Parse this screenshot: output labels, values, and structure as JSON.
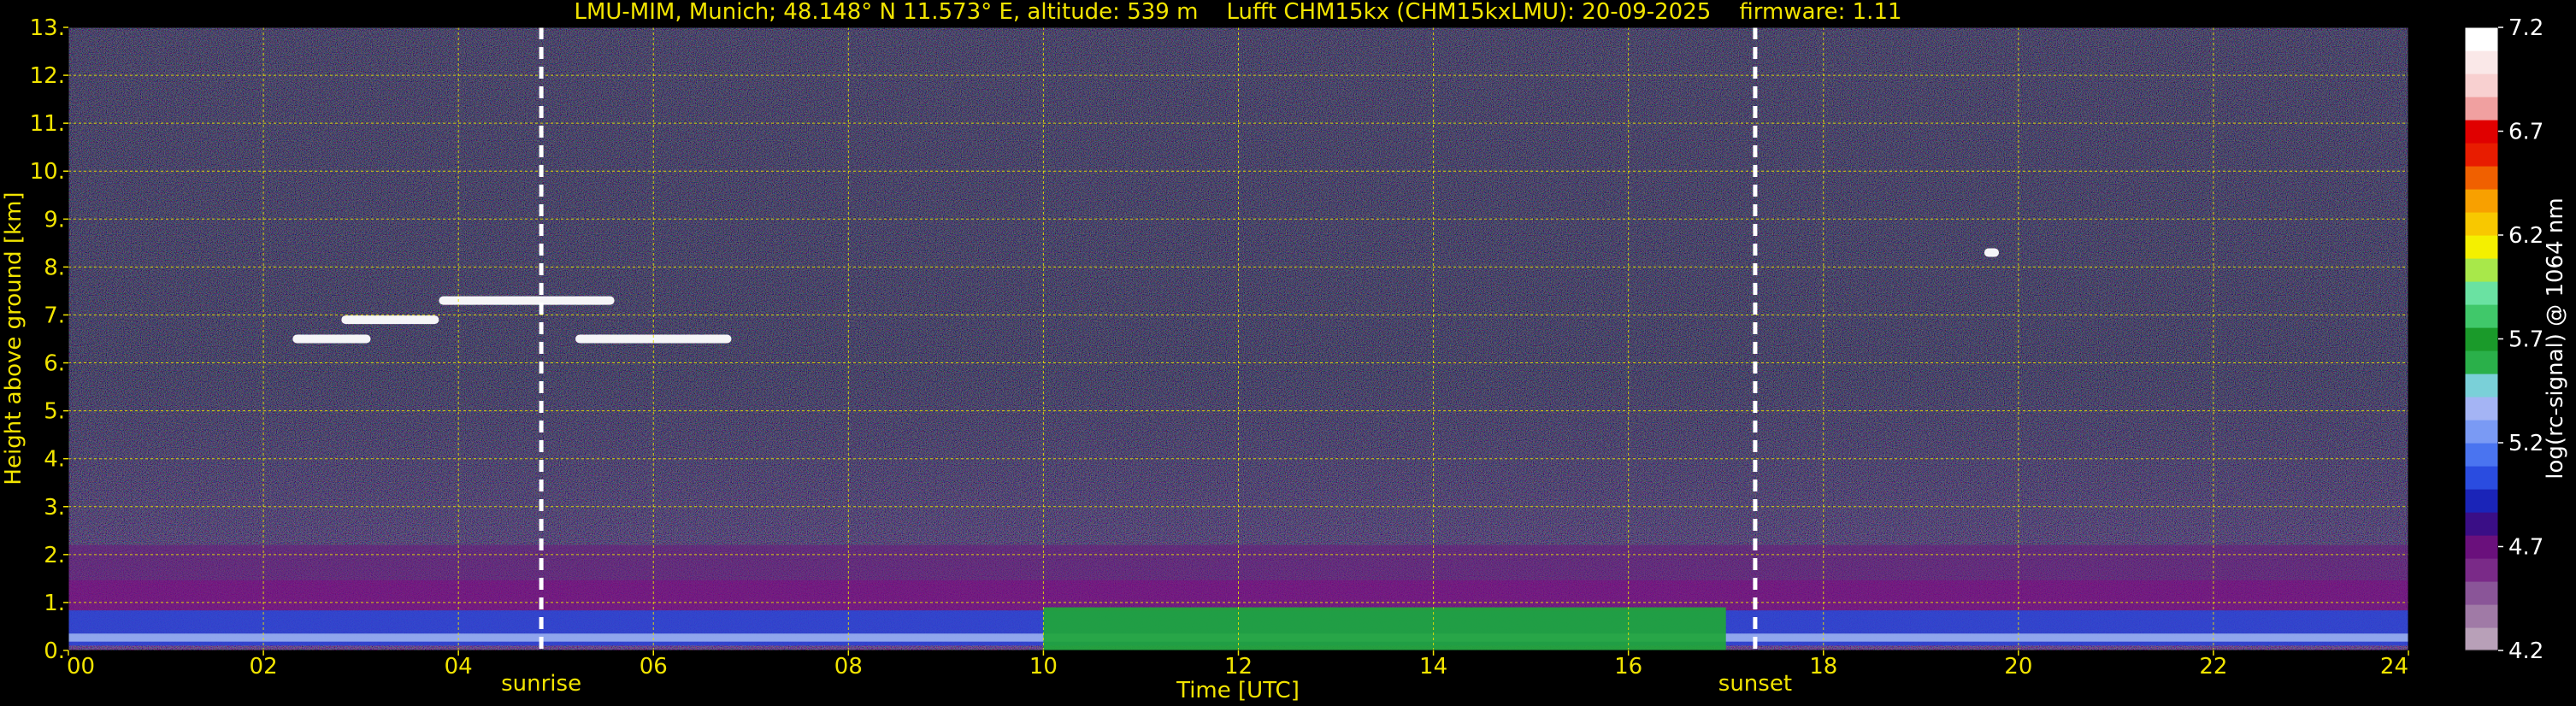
{
  "chart_data": {
    "type": "heatmap",
    "title": "LMU-MIM, Munich; 48.148° N 11.573° E, altitude: 539 m    Lufft CHM15kx (CHM15kxLMU): 20-09-2025    firmware: 1.11",
    "xlabel": "Time [UTC]",
    "ylabel": "Height above ground [km]",
    "colorbar_label": "log(rc-signal) @ 1064 nm",
    "xlim": [
      0,
      24
    ],
    "ylim": [
      0,
      13
    ],
    "x_ticks": [
      {
        "value": 0,
        "label": "00"
      },
      {
        "value": 2,
        "label": "02"
      },
      {
        "value": 4,
        "label": "04"
      },
      {
        "value": 6,
        "label": "06"
      },
      {
        "value": 8,
        "label": "08"
      },
      {
        "value": 10,
        "label": "10"
      },
      {
        "value": 12,
        "label": "12"
      },
      {
        "value": 14,
        "label": "14"
      },
      {
        "value": 16,
        "label": "16"
      },
      {
        "value": 18,
        "label": "18"
      },
      {
        "value": 20,
        "label": "20"
      },
      {
        "value": 22,
        "label": "22"
      },
      {
        "value": 24,
        "label": "24"
      }
    ],
    "y_ticks": [
      {
        "value": 0,
        "label": "0."
      },
      {
        "value": 1,
        "label": "1."
      },
      {
        "value": 2,
        "label": "2."
      },
      {
        "value": 3,
        "label": "3."
      },
      {
        "value": 4,
        "label": "4."
      },
      {
        "value": 5,
        "label": "5."
      },
      {
        "value": 6,
        "label": "6."
      },
      {
        "value": 7,
        "label": "7."
      },
      {
        "value": 8,
        "label": "8."
      },
      {
        "value": 9,
        "label": "9."
      },
      {
        "value": 10,
        "label": "10."
      },
      {
        "value": 11,
        "label": "11."
      },
      {
        "value": 12,
        "label": "12."
      },
      {
        "value": 13,
        "label": "13."
      }
    ],
    "colorbar_range": [
      4.2,
      7.2
    ],
    "colorbar_ticks": [
      {
        "value": 4.2,
        "label": "4.2"
      },
      {
        "value": 4.7,
        "label": "4.7"
      },
      {
        "value": 5.2,
        "label": "5.2"
      },
      {
        "value": 5.7,
        "label": "5.7"
      },
      {
        "value": 6.2,
        "label": "6.2"
      },
      {
        "value": 6.7,
        "label": "6.7"
      },
      {
        "value": 7.2,
        "label": "7.2"
      }
    ],
    "colorbar_colors": [
      "#b8a0b8",
      "#a07aa6",
      "#8a5598",
      "#7a2a88",
      "#6a107c",
      "#3a0e86",
      "#1a24b8",
      "#2a4ce0",
      "#4a74f0",
      "#7a9af4",
      "#a4b4f4",
      "#7ad0d8",
      "#2ab04a",
      "#1a9a2a",
      "#40c86a",
      "#6ae2a2",
      "#a8e84a",
      "#f4f000",
      "#f8c800",
      "#f8a000",
      "#f06000",
      "#e81c00",
      "#e00000",
      "#f0a0a0",
      "#f8d0d0",
      "#fae8e8",
      "#ffffff"
    ],
    "vertical_markers": [
      {
        "x": 4.85,
        "label": "sunrise"
      },
      {
        "x": 17.3,
        "label": "sunset"
      }
    ],
    "grid": true,
    "features": [
      {
        "kind": "cloud",
        "x_range": [
          2.3,
          3.1
        ],
        "height_km": 6.5
      },
      {
        "kind": "cloud",
        "x_range": [
          2.8,
          3.8
        ],
        "height_km": 6.9
      },
      {
        "kind": "cloud",
        "x_range": [
          3.8,
          5.6
        ],
        "height_km": 7.3
      },
      {
        "kind": "cloud",
        "x_range": [
          5.2,
          6.8
        ],
        "height_km": 6.5
      },
      {
        "kind": "cloud",
        "x_range": [
          19.65,
          19.8
        ],
        "height_km": 8.3
      },
      {
        "kind": "aerosol_layer",
        "x_range": [
          0,
          24
        ],
        "height_km_range": [
          0.1,
          2.2
        ]
      },
      {
        "kind": "boundary_layer",
        "x_range": [
          10,
          17
        ],
        "height_km_range": [
          0,
          0.9
        ]
      }
    ]
  }
}
